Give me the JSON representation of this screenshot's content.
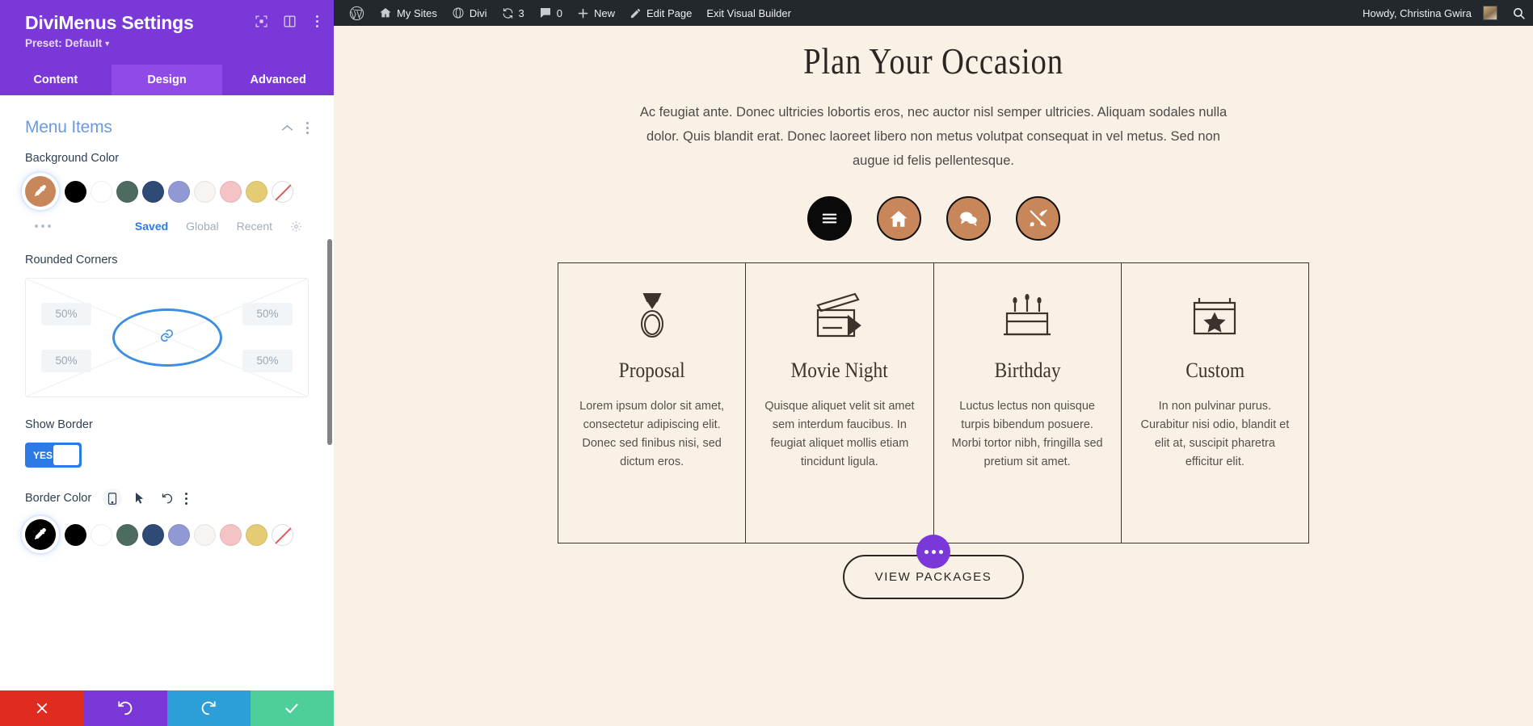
{
  "settings_panel": {
    "title": "DiviMenus Settings",
    "preset": "Preset: Default",
    "preset_caret": "▾",
    "header_icons": [
      {
        "name": "focus-icon",
        "glyph": "⛶"
      },
      {
        "name": "layout-icon",
        "glyph": "▥"
      },
      {
        "name": "more-options-icon",
        "glyph": "⋮"
      }
    ],
    "tabs": [
      {
        "label": "Content",
        "active": false
      },
      {
        "label": "Design",
        "active": true
      },
      {
        "label": "Advanced",
        "active": false
      }
    ],
    "section": {
      "title": "Menu Items",
      "collapse_icon": "chevron-up-icon",
      "more_icon": "more-options-icon"
    },
    "background_color": {
      "label": "Background Color",
      "selected": "#c8875a",
      "swatches": [
        "#000000",
        "#ffffff",
        "#4e6b60",
        "#2f4a74",
        "#9099d4",
        "#f7f4f2",
        "#f3c3c6",
        "#e3cc74",
        "none"
      ],
      "footer": {
        "more": "...",
        "tabs": [
          {
            "label": "Saved",
            "active": true
          },
          {
            "label": "Global",
            "active": false
          },
          {
            "label": "Recent",
            "active": false
          }
        ],
        "settings_icon": "gear-icon"
      }
    },
    "rounded_corners": {
      "label": "Rounded Corners",
      "top_left": "50%",
      "top_right": "50%",
      "bottom_left": "50%",
      "bottom_right": "50%",
      "link_icon": "link-icon"
    },
    "show_border": {
      "label": "Show Border",
      "value": "YES"
    },
    "border_color": {
      "label": "Border Color",
      "icons": [
        {
          "name": "mobile-icon"
        },
        {
          "name": "cursor-icon"
        },
        {
          "name": "reset-icon"
        },
        {
          "name": "more-options-icon"
        }
      ],
      "selected": "#000000",
      "swatches": [
        "#000000",
        "#ffffff",
        "#4e6b60",
        "#2f4a74",
        "#9099d4",
        "#f7f4f2",
        "#f3c3c6",
        "#e3cc74",
        "none"
      ]
    },
    "footer_buttons": [
      {
        "name": "cancel-button",
        "glyph": "✕",
        "color": "#e02b20"
      },
      {
        "name": "undo-button",
        "glyph": "↺",
        "color": "#7b38d8"
      },
      {
        "name": "redo-button",
        "glyph": "↻",
        "color": "#2c9fd8"
      },
      {
        "name": "save-button",
        "glyph": "✓",
        "color": "#4ecf9a"
      }
    ]
  },
  "admin_bar": {
    "items": [
      {
        "label": "",
        "icon": "wordpress-logo-icon"
      },
      {
        "label": "My Sites",
        "icon": "sites-icon"
      },
      {
        "label": "Divi",
        "icon": "divi-icon"
      },
      {
        "label": "3",
        "icon": "updates-icon"
      },
      {
        "label": "0",
        "icon": "comments-icon"
      },
      {
        "label": "New",
        "icon": "plus-icon"
      },
      {
        "label": "Edit Page",
        "icon": "pencil-icon"
      },
      {
        "label": "Exit Visual Builder",
        "icon": ""
      }
    ],
    "howdy": "Howdy, Christina Gwira",
    "search_icon": "search-icon"
  },
  "preview": {
    "heading": "Plan Your Occasion",
    "paragraph": "Ac feugiat ante. Donec ultricies lobortis eros, nec auctor nisl semper ultricies. Aliquam sodales nulla dolor. Quis blandit erat. Donec laoreet libero non metus volutpat consequat in vel metus. Sed non augue id felis pellentesque.",
    "menu_buttons": [
      {
        "name": "hamburger-menu-button",
        "icon": "hamburger-icon",
        "style": "dark",
        "color": "#0a0a0a"
      },
      {
        "name": "home-button",
        "icon": "home-icon",
        "style": "tan",
        "color": "#c8875a"
      },
      {
        "name": "chat-button",
        "icon": "chat-bubbles-icon",
        "style": "tan",
        "color": "#c8875a"
      },
      {
        "name": "tools-button",
        "icon": "tools-icon",
        "style": "tan",
        "color": "#c8875a"
      }
    ],
    "cards": [
      {
        "icon": "ring-icon",
        "title": "Proposal",
        "text": "Lorem ipsum dolor sit amet, consectetur adipiscing elit. Donec sed finibus nisi, sed dictum eros."
      },
      {
        "icon": "clapperboard-icon",
        "title": "Movie Night",
        "text": "Quisque aliquet velit sit amet sem interdum faucibus. In feugiat aliquet mollis etiam tincidunt ligula."
      },
      {
        "icon": "birthday-cake-icon",
        "title": "Birthday",
        "text": "Luctus lectus non quisque turpis bibendum posuere. Morbi tortor nibh, fringilla sed pretium sit amet."
      },
      {
        "icon": "star-gift-icon",
        "title": "Custom",
        "text": "In non pulvinar purus. Curabitur nisi odio, blandit et elit at, suscipit pharetra efficitur elit."
      }
    ],
    "cta_label": "VIEW PACKAGES",
    "cta_badge": "more-options-icon"
  },
  "colors": {
    "brand_purple": "#7b38d8",
    "accent_blue": "#2c7be5",
    "page_bg": "#faf1e6",
    "tan": "#c8875a",
    "admin_bar_bg": "#23282d"
  }
}
